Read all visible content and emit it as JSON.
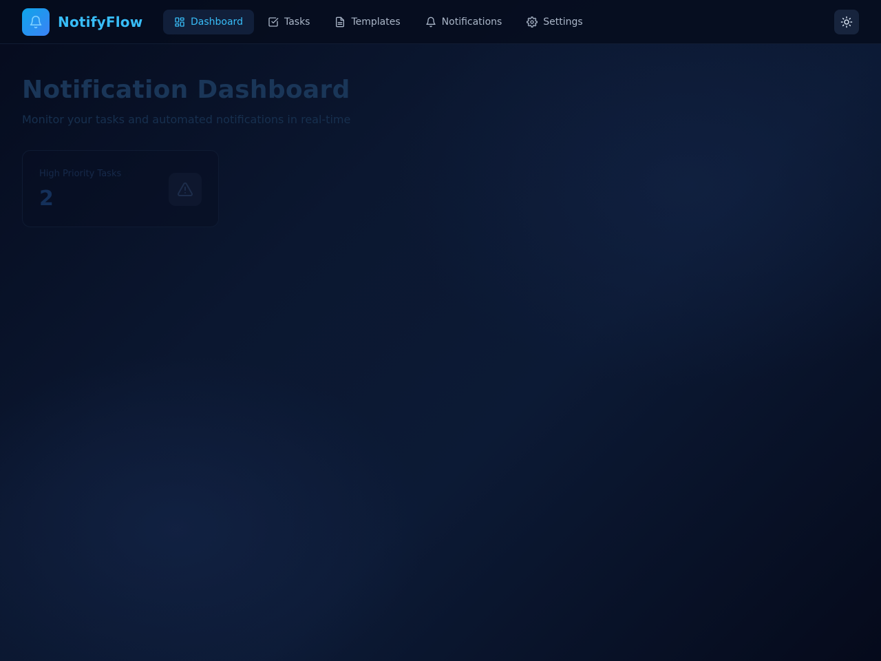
{
  "app": {
    "name": "NotifyFlow",
    "logo_icon": "bell-icon"
  },
  "nav": {
    "items": [
      {
        "label": "Dashboard",
        "icon": "dashboard-grid-icon",
        "active": true
      },
      {
        "label": "Tasks",
        "icon": "checkbox-icon",
        "active": false
      },
      {
        "label": "Templates",
        "icon": "document-icon",
        "active": false
      },
      {
        "label": "Notifications",
        "icon": "bell-icon",
        "active": false
      },
      {
        "label": "Settings",
        "icon": "gear-icon",
        "active": false
      }
    ]
  },
  "header": {
    "theme_toggle_icon": "sun-icon"
  },
  "main": {
    "title": "Notification Dashboard",
    "subtitle": "Monitor your tasks and automated notifications in real-time",
    "stats": [
      {
        "label": "High Priority Tasks",
        "value": "2",
        "icon": "warning-triangle-icon"
      }
    ]
  },
  "colors": {
    "accent": "#38bdf8",
    "background": "#0b1730",
    "header_bg": "#060c1e",
    "active_nav_bg": "#111f3a"
  }
}
